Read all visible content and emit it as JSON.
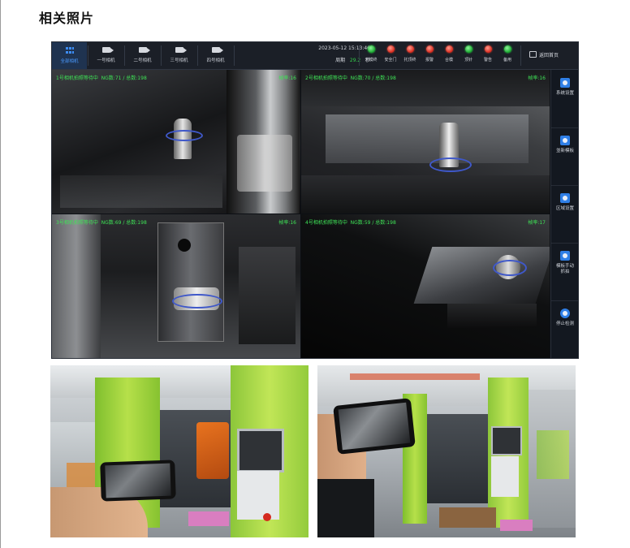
{
  "heading": "相关照片",
  "app": {
    "tabs": [
      {
        "label": "全部相机",
        "active": true
      },
      {
        "label": "一号相机",
        "active": false
      },
      {
        "label": "二号相机",
        "active": false
      },
      {
        "label": "三号相机",
        "active": false
      },
      {
        "label": "四号相机",
        "active": false
      }
    ],
    "datetime": "2023-05-12 15:13:46",
    "cycle_label": "周期",
    "cycle_value": "29.2",
    "cycle_unit": "秒",
    "indicators": [
      {
        "label": "开模终",
        "color": "green"
      },
      {
        "label": "安全门",
        "color": "red"
      },
      {
        "label": "托顶终",
        "color": "red"
      },
      {
        "label": "报警",
        "color": "red"
      },
      {
        "label": "合模",
        "color": "red"
      },
      {
        "label": "顶针",
        "color": "green"
      },
      {
        "label": "警告",
        "color": "red"
      },
      {
        "label": "备用",
        "color": "green"
      }
    ],
    "home_label": "返回首页",
    "cameras": [
      {
        "status": "1号相机拍照等待中",
        "counts": "NG数:71 / 总数:198",
        "fps": "帧率:16"
      },
      {
        "status": "2号相机拍照等待中",
        "counts": "NG数:70 / 总数:198",
        "fps": "帧率:16"
      },
      {
        "status": "3号相机拍照等待中",
        "counts": "NG数:69 / 总数:198",
        "fps": "帧率:16"
      },
      {
        "status": "4号相机拍照等待中",
        "counts": "NG数:59 / 总数:198",
        "fps": "帧率:17"
      }
    ],
    "sidebar": [
      {
        "label": "系统设置"
      },
      {
        "label": "並新模板"
      },
      {
        "label": "区域设置"
      },
      {
        "label": "模板手动抓拍"
      },
      {
        "label": "停止检测"
      }
    ]
  }
}
